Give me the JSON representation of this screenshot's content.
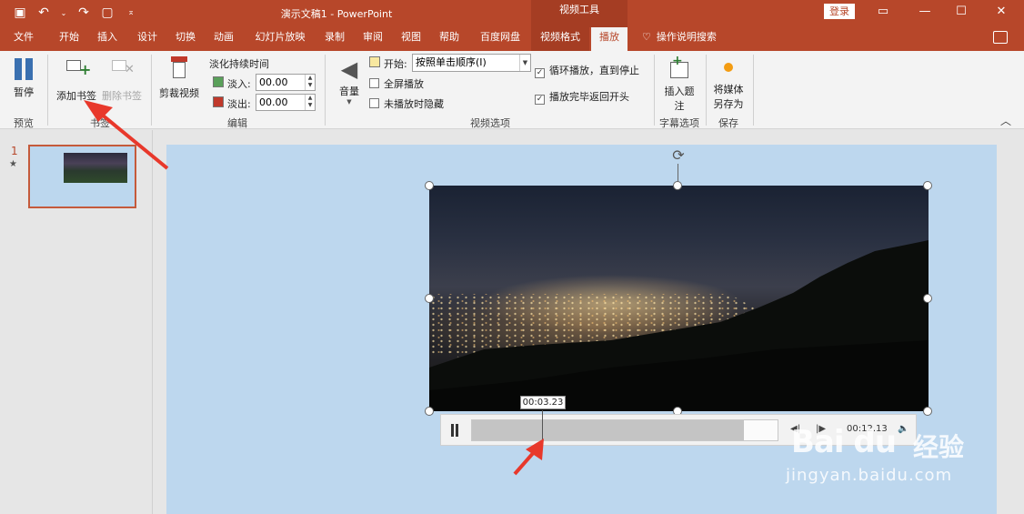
{
  "title_bar": {
    "document_title": "演示文稿1 - PowerPoint",
    "context_group": "视频工具",
    "login_label": "登录"
  },
  "tabs": [
    {
      "label": "文件"
    },
    {
      "label": "开始"
    },
    {
      "label": "插入"
    },
    {
      "label": "设计"
    },
    {
      "label": "切换"
    },
    {
      "label": "动画"
    },
    {
      "label": "幻灯片放映"
    },
    {
      "label": "录制"
    },
    {
      "label": "审阅"
    },
    {
      "label": "视图"
    },
    {
      "label": "帮助"
    },
    {
      "label": "百度网盘"
    },
    {
      "label": "视频格式"
    },
    {
      "label": "播放"
    }
  ],
  "tell_me": "操作说明搜索",
  "ribbon": {
    "pause_label": "暂停",
    "preview_group": "预览",
    "add_bookmark": "添加书签",
    "remove_bookmark": "删除书签",
    "bookmark_group": "书签",
    "trim_video": "剪裁视频",
    "fade_duration": "淡化持续时间",
    "fade_in_label": "淡入:",
    "fade_in_value": "00.00",
    "fade_out_label": "淡出:",
    "fade_out_value": "00.00",
    "edit_group": "编辑",
    "volume": "音量",
    "start_label": "开始:",
    "start_value": "按照单击顺序(I)",
    "fullscreen": "全屏播放",
    "hide_not_playing": "未播放时隐藏",
    "loop_label": "循环播放，直到停止",
    "rewind_label": "播放完毕返回开头",
    "video_options_group": "视频选项",
    "insert_caption_1": "插入题",
    "insert_caption_2": "注",
    "caption_group": "字幕选项",
    "save_media_1": "将媒体",
    "save_media_2": "另存为",
    "save_group": "保存"
  },
  "slides_panel": {
    "slide_number": "1",
    "star": "★"
  },
  "player": {
    "bookmark_time": "00:03.23",
    "current_time": "00:12.13",
    "progress": 0.89
  },
  "watermark": {
    "logo": "Bai du",
    "cn": "经验",
    "url": "jingyan.baidu.com"
  }
}
